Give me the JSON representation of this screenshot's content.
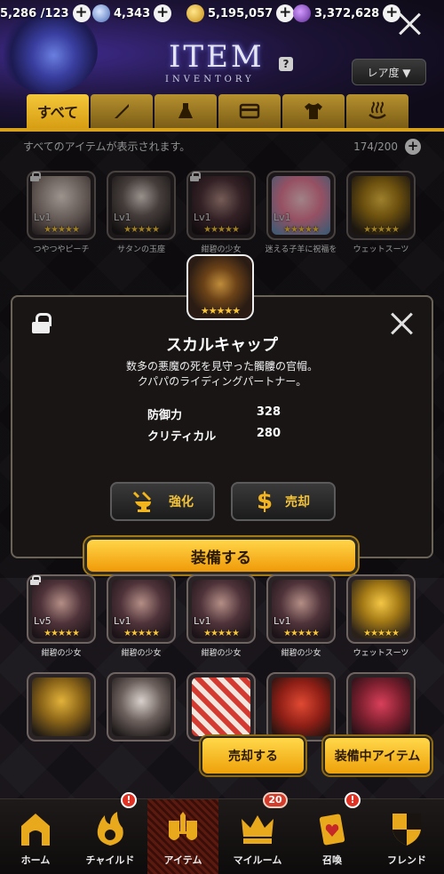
{
  "header": {
    "title": "ITEM",
    "subtitle": "INVENTORY",
    "help_label": "?",
    "sort_label": "レア度 ▼",
    "currencies": [
      {
        "value": "5,286 /123",
        "icon": "stamina-icon"
      },
      {
        "value": "4,343",
        "icon": "crystal-icon"
      },
      {
        "value": "5,195,057",
        "icon": "gold-coin-icon"
      },
      {
        "value": "3,372,628",
        "icon": "purple-gem-icon"
      }
    ]
  },
  "tabs": [
    {
      "label": "すべて",
      "icon": "all-tab",
      "active": true
    },
    {
      "label": "",
      "icon": "weapon-icon"
    },
    {
      "label": "",
      "icon": "flask-icon"
    },
    {
      "label": "",
      "icon": "card-icon"
    },
    {
      "label": "",
      "icon": "shirt-icon"
    },
    {
      "label": "",
      "icon": "hot-spring-icon"
    }
  ],
  "inventory": {
    "status_text": "すべてのアイテムが表示されます。",
    "count": "174/200"
  },
  "items_row1": [
    {
      "name": "つやつやピーチ",
      "level": "Lv1",
      "stars": "★★★★★"
    },
    {
      "name": "サタンの玉座",
      "level": "Lv1",
      "stars": "★★★★★"
    },
    {
      "name": "紺碧の少女",
      "level": "Lv1",
      "stars": "★★★★★"
    },
    {
      "name": "迷える子羊に祝福を",
      "level": "Lv1",
      "stars": "★★★★★"
    },
    {
      "name": "ウェットスーツ",
      "level": "",
      "stars": "★★★★★"
    }
  ],
  "items_row4": [
    {
      "name": "紺碧の少女",
      "level": "Lv5",
      "stars": "★★★★★"
    },
    {
      "name": "紺碧の少女",
      "level": "Lv1",
      "stars": "★★★★★"
    },
    {
      "name": "紺碧の少女",
      "level": "Lv1",
      "stars": "★★★★★"
    },
    {
      "name": "紺碧の少女",
      "level": "Lv1",
      "stars": "★★★★★"
    },
    {
      "name": "ウェットスーツ",
      "level": "",
      "stars": "★★★★★"
    }
  ],
  "modal": {
    "title": "スカルキャップ",
    "description_line1": "数多の悪魔の死を見守った髑髏の官帽。",
    "description_line2": "クパパのライディングパートナー。",
    "stats": [
      {
        "label": "防御力",
        "value": "328"
      },
      {
        "label": "クリティカル",
        "value": "280"
      }
    ],
    "enhance_label": "強化",
    "sell_label": "売却",
    "equip_label": "装備する",
    "item_stars": "★★★★★"
  },
  "actions": {
    "sell_label": "売却する",
    "equipped_label": "装備中アイテム"
  },
  "nav": [
    {
      "label": "ホーム",
      "icon": "home-icon"
    },
    {
      "label": "チャイルド",
      "icon": "child-flame-icon",
      "badge": "!"
    },
    {
      "label": "アイテム",
      "icon": "item-sword-shield-icon",
      "active": true
    },
    {
      "label": "マイルーム",
      "icon": "crown-icon",
      "badge": "20"
    },
    {
      "label": "召喚",
      "icon": "summon-card-icon",
      "badge": "!"
    },
    {
      "label": "フレンド",
      "icon": "friend-shield-icon"
    }
  ],
  "colors": {
    "accent": "#f2b51c",
    "tab_active": "#f4c73a",
    "badge": "#e03224"
  }
}
